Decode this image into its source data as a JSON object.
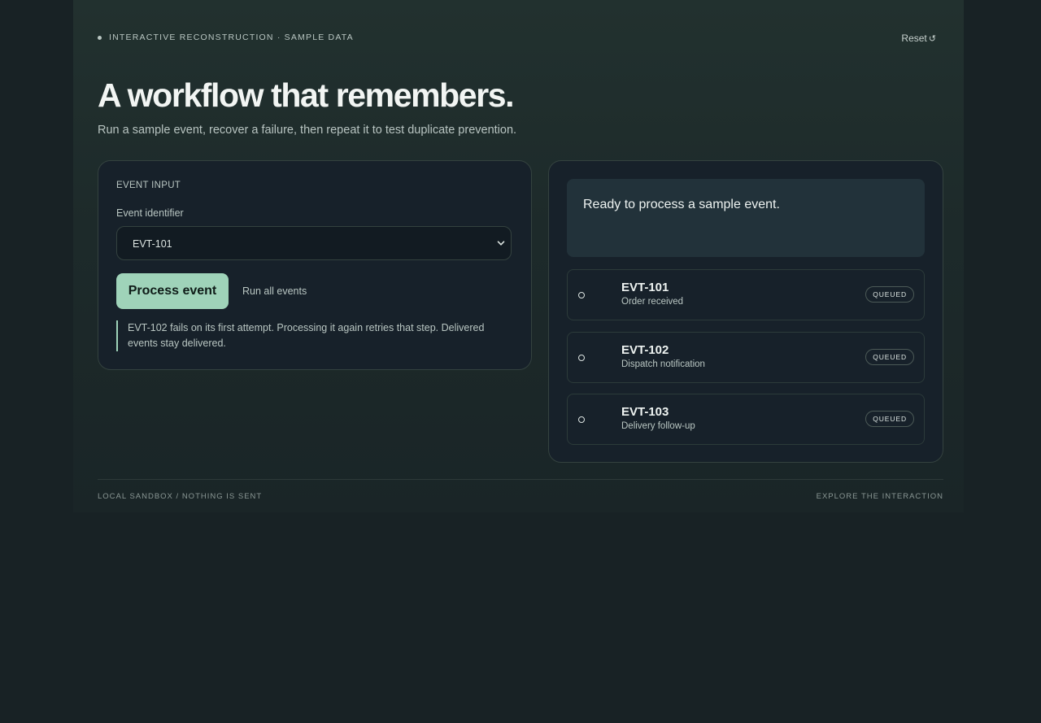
{
  "header": {
    "eyebrow": "INTERACTIVE RECONSTRUCTION · SAMPLE DATA",
    "reset_label": "Reset",
    "reset_icon": "↺"
  },
  "hero": {
    "title": "A workflow that remembers.",
    "subtitle": "Run a sample event, recover a failure, then repeat it to test duplicate prevention."
  },
  "input_card": {
    "section_label": "EVENT INPUT",
    "field_label": "Event identifier",
    "selected_event": "EVT-101",
    "process_button": "Process event",
    "run_all_button": "Run all events",
    "note": "EVT-102 fails on its first attempt. Processing it again retries that step. Delivered events stay delivered."
  },
  "output_card": {
    "status_message": "Ready to process a sample event.",
    "events": [
      {
        "id": "EVT-101",
        "description": "Order received",
        "status": "QUEUED"
      },
      {
        "id": "EVT-102",
        "description": "Dispatch notification",
        "status": "QUEUED"
      },
      {
        "id": "EVT-103",
        "description": "Delivery follow-up",
        "status": "QUEUED"
      }
    ]
  },
  "footer": {
    "left": "LOCAL SANDBOX / NOTHING IS SENT",
    "right": "EXPLORE THE INTERACTION"
  },
  "colors": {
    "accent": "#9fd3b9",
    "background": "#182225",
    "card": "#17212a"
  }
}
